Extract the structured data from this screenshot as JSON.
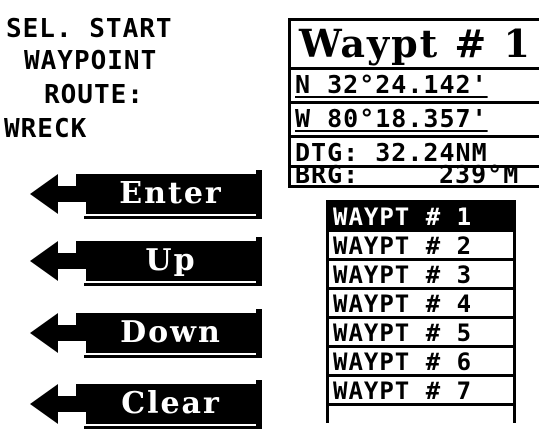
{
  "info": {
    "line1": "SEL. START",
    "line2": "WAYPOINT",
    "line3": "ROUTE:",
    "line4": "WRECK"
  },
  "softkeys": [
    {
      "label": "Enter",
      "icon": "return-arrow-icon"
    },
    {
      "label": "Up",
      "icon": "return-arrow-icon"
    },
    {
      "label": "Down",
      "icon": "return-arrow-icon"
    },
    {
      "label": "Clear",
      "icon": "return-arrow-icon"
    }
  ],
  "waypoint_box": {
    "title": "Waypt # 1",
    "latitude": "N 32°24.142'",
    "longitude": "W 80°18.357'",
    "dtg": "DTG: 32.24NM",
    "brg_label": "BRG:",
    "brg_value": "239°M"
  },
  "waypoint_list": {
    "selected_index": 0,
    "items": [
      "WAYPT # 1",
      "WAYPT # 2",
      "WAYPT # 3",
      "WAYPT # 4",
      "WAYPT # 5",
      "WAYPT # 6",
      "WAYPT # 7"
    ]
  },
  "colors": {
    "foreground": "#000000",
    "background": "#ffffff"
  }
}
